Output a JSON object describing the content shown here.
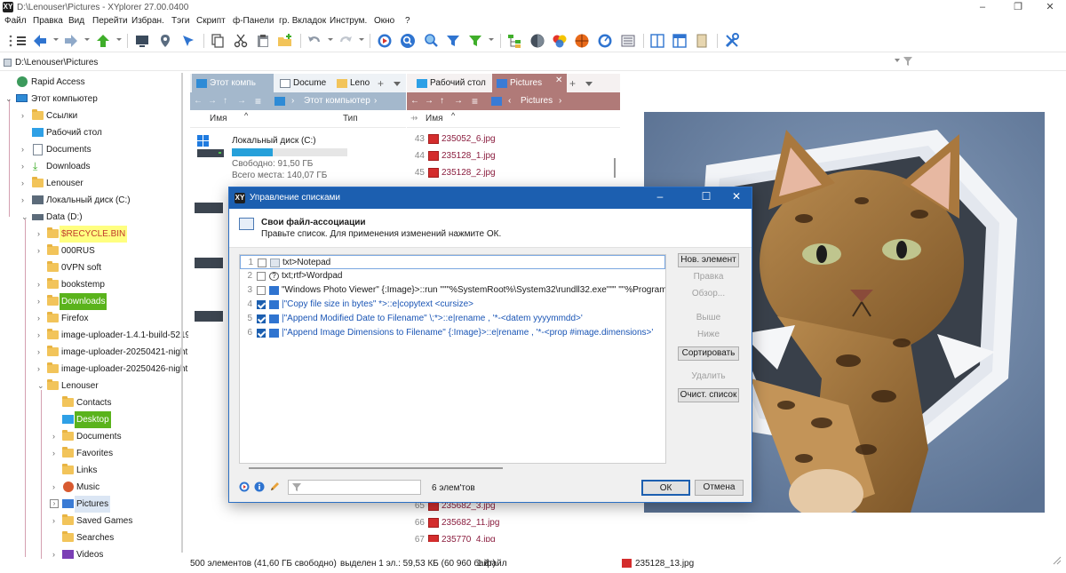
{
  "window": {
    "title": "D:\\Lenouser\\Pictures - XYplorer 27.00.0400",
    "logo": "XY",
    "minimize": "–",
    "maximize": "❐",
    "close": "✕"
  },
  "menu": [
    "Файл",
    "Правка",
    "Вид",
    "Перейти",
    "Избран.",
    "Тэги",
    "Скрипт",
    "ф-Панели",
    "гр. Вкладок",
    "Инструм.",
    "Окно",
    "?"
  ],
  "address": {
    "path": "D:\\Lenouser\\Pictures"
  },
  "tree": {
    "items": [
      {
        "label": "Rapid Access"
      },
      {
        "label": "Этот компьютер"
      },
      {
        "label": "Ссылки"
      },
      {
        "label": "Рабочий стол"
      },
      {
        "label": "Documents"
      },
      {
        "label": "Downloads"
      },
      {
        "label": "Lenouser"
      },
      {
        "label": "Локальный диск (C:)"
      },
      {
        "label": "Data (D:)"
      },
      {
        "label": "$RECYCLE.BIN"
      },
      {
        "label": "000RUS"
      },
      {
        "label": "0VPN soft"
      },
      {
        "label": "bookstemp"
      },
      {
        "label": "Downloads"
      },
      {
        "label": "Firefox"
      },
      {
        "label": "image-uploader-1.4.1-build-5219"
      },
      {
        "label": "image-uploader-20250421-night"
      },
      {
        "label": "image-uploader-20250426-night"
      },
      {
        "label": "Lenouser"
      },
      {
        "label": "Contacts"
      },
      {
        "label": "Desktop"
      },
      {
        "label": "Documents"
      },
      {
        "label": "Favorites"
      },
      {
        "label": "Links"
      },
      {
        "label": "Music"
      },
      {
        "label": "Pictures"
      },
      {
        "label": "Saved Games"
      },
      {
        "label": "Searches"
      },
      {
        "label": "Videos"
      }
    ]
  },
  "left_pane": {
    "tabs": [
      {
        "label": "Этот компь"
      },
      {
        "label": "Docume"
      },
      {
        "label": "Lenо"
      }
    ],
    "tab_add": "+",
    "nav_path": "Этот компьютер",
    "col_name": "Имя",
    "col_type": "Тип",
    "drive": {
      "name": "Локальный диск (C:)",
      "free": "Свободно: 91,50 ГБ",
      "total": "Всего места: 140,07 ГБ",
      "used_fraction": 0.35
    }
  },
  "right_pane": {
    "tabs": [
      {
        "label": "Рабочий стол"
      },
      {
        "label": "Pictures"
      }
    ],
    "tab_add": "+",
    "nav_path": "Pictures",
    "col_name": "Имя",
    "files_top": [
      {
        "num": "43",
        "name": "235052_6.jpg"
      },
      {
        "num": "44",
        "name": "235128_1.jpg"
      },
      {
        "num": "45",
        "name": "235128_2.jpg"
      }
    ],
    "files_bottom": [
      {
        "num": "65",
        "name": "235682_3.jpg"
      },
      {
        "num": "66",
        "name": "235682_11.jpg"
      },
      {
        "num": "67",
        "name": "235770_4.jpg"
      }
    ]
  },
  "status": {
    "items": "500 элементов (41,60 ГБ свободно)",
    "selected": "выделен 1 эл.: 59,53 КБ (60 960 байт)",
    "files": "1 файл",
    "current_file": "235128_13.jpg"
  },
  "dialog": {
    "title": "Управление списками",
    "heading": "Свои файл-ассоциации",
    "subheading": "Правьте список. Для применения изменений нажмите ОК.",
    "rows": [
      {
        "num": "1",
        "text": "txt>Notepad",
        "checked": false
      },
      {
        "num": "2",
        "text": "txt;rtf>Wordpad",
        "checked": false
      },
      {
        "num": "3",
        "text": "\"Windows Photo Viewer\" {:Image}>::run \"\"\"%SystemRoot%\\System32\\rundll32.exe\"\"\" \"\"%ProgramFiles%\\Windows",
        "checked": false
      },
      {
        "num": "4",
        "text": "|\"Copy file size in bytes\" *>::e|copytext <cursize>",
        "checked": true
      },
      {
        "num": "5",
        "text": "|\"Append Modified Date to Filename\" \\;*>::e|rename , '*-<datem yyyymmdd>'",
        "checked": true
      },
      {
        "num": "6",
        "text": "|\"Append Image Dimensions to Filename\" {:Image}>::e|rename , '*-<prop #image.dimensions>'",
        "checked": true
      }
    ],
    "buttons": {
      "new": "Нов. элемент",
      "edit": "Правка",
      "browse": "Обзор...",
      "up": "Выше",
      "down": "Ниже",
      "sort": "Сортировать",
      "delete": "Удалить",
      "clear": "Очист. список"
    },
    "count": "6 элем'тов",
    "ok": "ОК",
    "cancel": "Отмена"
  },
  "colors": {
    "accent": "#1c5fb0",
    "left_nav": "#a4b8cc",
    "right_nav": "#b07a78",
    "highlight_green": "#5ab31c",
    "highlight_yellow": "#ffff80"
  }
}
